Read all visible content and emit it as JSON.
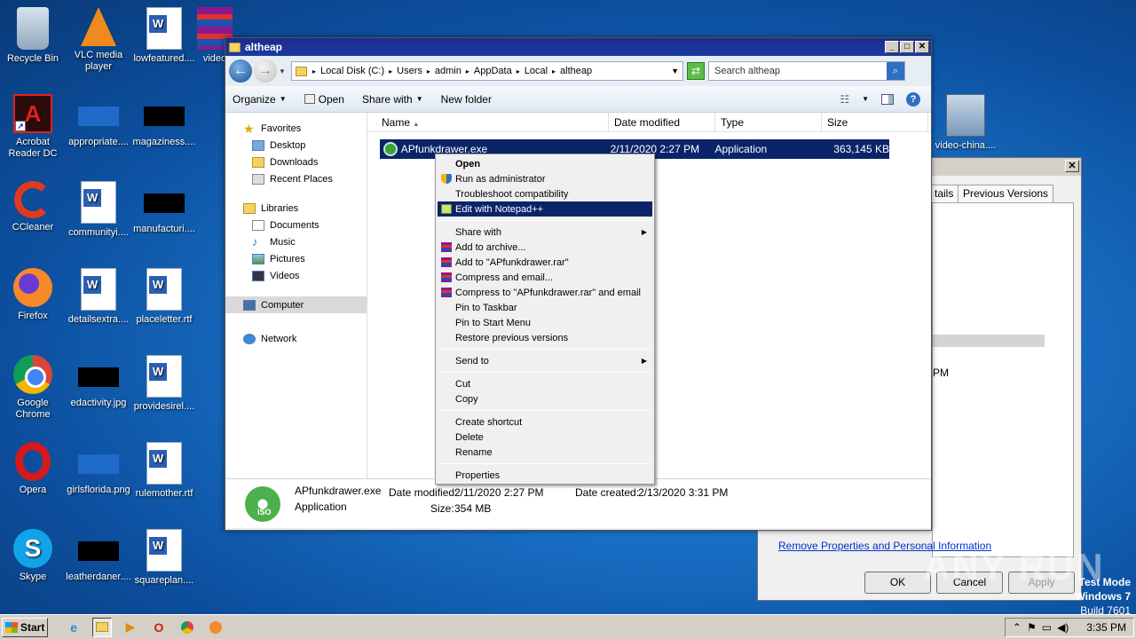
{
  "desktop": {
    "icons": [
      {
        "label": "Recycle Bin",
        "icon": "recycle-bin-icon"
      },
      {
        "label": "VLC media player",
        "icon": "vlc-icon"
      },
      {
        "label": "lowfeatured....",
        "icon": "word-doc-icon"
      },
      {
        "label": "video",
        "icon": "winrar-icon"
      },
      {
        "label": "Acrobat Reader DC",
        "icon": "acrobat-icon"
      },
      {
        "label": "appropriate....",
        "icon": "blue-file-icon"
      },
      {
        "label": "magaziness....",
        "icon": "black-file-icon"
      },
      {
        "label": "CCleaner",
        "icon": "ccleaner-icon"
      },
      {
        "label": "communityi....",
        "icon": "word-doc-icon"
      },
      {
        "label": "manufacturi....",
        "icon": "black-file-icon"
      },
      {
        "label": "Firefox",
        "icon": "firefox-icon"
      },
      {
        "label": "detailsextra....",
        "icon": "word-doc-icon"
      },
      {
        "label": "placeletter.rtf",
        "icon": "word-doc-icon"
      },
      {
        "label": "Google Chrome",
        "icon": "chrome-icon"
      },
      {
        "label": "edactivity.jpg",
        "icon": "black-file-icon"
      },
      {
        "label": "providesirel....",
        "icon": "word-doc-icon"
      },
      {
        "label": "Opera",
        "icon": "opera-icon"
      },
      {
        "label": "girlsflorida.png",
        "icon": "blue-file-icon"
      },
      {
        "label": "rulemother.rtf",
        "icon": "word-doc-icon"
      },
      {
        "label": "Skype",
        "icon": "skype-icon"
      },
      {
        "label": "leatherdaner....",
        "icon": "black-file-icon"
      },
      {
        "label": "squareplan....",
        "icon": "word-doc-icon"
      },
      {
        "label": "video-china....",
        "icon": "video-installer-icon"
      }
    ]
  },
  "explorer": {
    "title": "altheap",
    "breadcrumb": [
      "Local Disk (C:)",
      "Users",
      "admin",
      "AppData",
      "Local",
      "altheap"
    ],
    "search_placeholder": "Search altheap",
    "toolbar": {
      "organize": "Organize",
      "open": "Open",
      "share_with": "Share with",
      "new_folder": "New folder"
    },
    "nav": {
      "favorites": "Favorites",
      "desktop": "Desktop",
      "downloads": "Downloads",
      "recent_places": "Recent Places",
      "libraries": "Libraries",
      "documents": "Documents",
      "music": "Music",
      "pictures": "Pictures",
      "videos": "Videos",
      "computer": "Computer",
      "network": "Network"
    },
    "columns": {
      "name": "Name",
      "date_modified": "Date modified",
      "type": "Type",
      "size": "Size"
    },
    "file": {
      "name": "APfunkdrawer.exe",
      "date_modified": "2/11/2020 2:27 PM",
      "type": "Application",
      "size": "363,145 KB"
    },
    "details": {
      "name": "APfunkdrawer.exe",
      "type": "Application",
      "date_modified_label": "Date modified:",
      "date_modified": "2/11/2020 2:27 PM",
      "date_created_label": "Date created:",
      "date_created": "2/13/2020 3:31 PM",
      "size_label": "Size:",
      "size": "354 MB",
      "icon_text": "ISO"
    }
  },
  "context_menu": {
    "open": "Open",
    "run_as_admin": "Run as administrator",
    "troubleshoot": "Troubleshoot compatibility",
    "edit_npp": "Edit with Notepad++",
    "share_with": "Share with",
    "add_archive": "Add to archive...",
    "add_rar": "Add to \"APfunkdrawer.rar\"",
    "compress_email": "Compress and email...",
    "compress_rar_email": "Compress to \"APfunkdrawer.rar\" and email",
    "pin_taskbar": "Pin to Taskbar",
    "pin_start": "Pin to Start Menu",
    "restore": "Restore previous versions",
    "send_to": "Send to",
    "cut": "Cut",
    "copy": "Copy",
    "create_shortcut": "Create shortcut",
    "delete": "Delete",
    "rename": "Rename",
    "properties": "Properties"
  },
  "properties_dialog": {
    "tab_details": "tails",
    "tab_previous": "Previous Versions",
    "partial_text": "PM",
    "remove_link": "Remove Properties and Personal Information",
    "ok": "OK",
    "cancel": "Cancel",
    "apply": "Apply"
  },
  "watermark": "ANY RUN",
  "system": {
    "test_mode": "Test Mode",
    "os": "Windows 7",
    "build": "Build 7601",
    "clock": "3:35 PM",
    "start": "Start"
  }
}
